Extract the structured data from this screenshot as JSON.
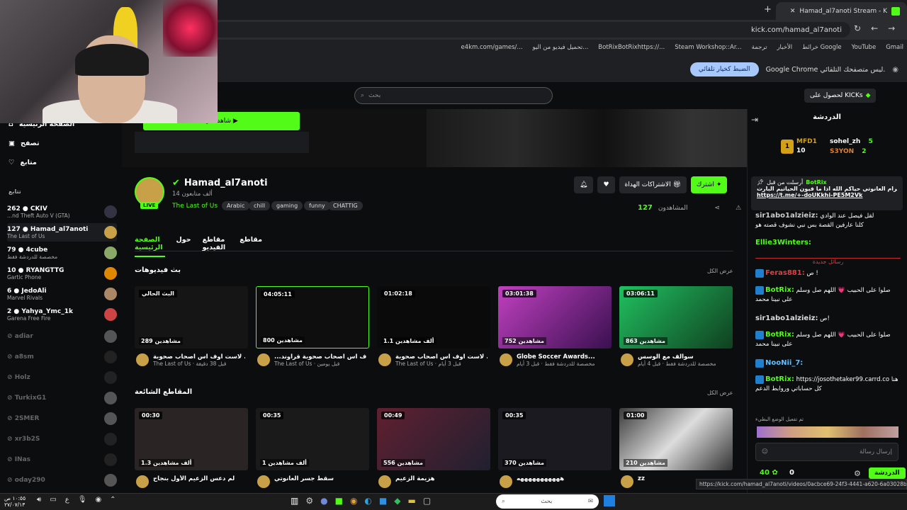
{
  "browser": {
    "tab_title": "Hamad_al7anoti Stream - K",
    "url": "kick.com/hamad_al7anoti",
    "bookmarks": [
      "Gmail",
      "YouTube",
      "خرائط Google",
      "الأخبار",
      "ترجمة",
      "Steam Workshop::Ar...",
      "BotRixBotRixhttps://...",
      "تحميل فيديو من اليو...",
      "e4km.com/games/..."
    ],
    "infobar_msg": "Google Chrome ليس متصفحك التلقائي.",
    "infobar_btn": "الضبط كخيار تلقائي"
  },
  "header": {
    "search_placeholder": "بحث",
    "kicks_label": "لحصول على KICKs"
  },
  "leftnav": {
    "items": [
      "الصفحة الرئيسية",
      "تصفح",
      "متابع"
    ],
    "following_label": "تتابع",
    "channels": [
      {
        "count": "262",
        "name": "CKIV",
        "game": "...nd Theft Auto V (GTA)"
      },
      {
        "count": "127",
        "name": "Hamad_al7anoti",
        "game": "The Last of Us"
      },
      {
        "count": "79",
        "name": "4cube",
        "game": "مخصصة للدردشة فقط"
      },
      {
        "count": "10",
        "name": "RYANGTTG",
        "game": "Gartic Phone"
      },
      {
        "count": "6",
        "name": "JedoAli",
        "game": "Marvel Rivals"
      },
      {
        "count": "2",
        "name": "Yahya_Ymc_1k",
        "game": "Garena Free Fire"
      }
    ],
    "offline": [
      "adiar",
      "a8sm",
      "Holz",
      "TurkixG1",
      "2SMER",
      "xr3b2S",
      "INas",
      "oday290"
    ]
  },
  "banner": {
    "watch_label": "شاهد الآن ▶"
  },
  "profile": {
    "name": "Hamad_al7anoti",
    "followers": "14 ألف متابعون",
    "category": "The Last of Us",
    "tags": [
      "Arabic",
      "chill",
      "gaming",
      "funny",
      "CHATTIG"
    ],
    "live": "LIVE",
    "subscribe": "اشترك",
    "gift": "الاشتراكات الهداة",
    "viewers_label": "المشاهدون",
    "viewers": "127"
  },
  "tabs": [
    "الصفحة الرئيسية",
    "حول",
    "مقاطع الفيديو",
    "مقاطع"
  ],
  "sections": {
    "vods_title": "بث فيديوهات",
    "clips_title": "المقاطع الشائعة",
    "view_all": "عرض الكل"
  },
  "vods": [
    {
      "dur": "البث الحالي",
      "views": "289 مشاهدين",
      "title": "لاست اوف اس اصحاب صحوبة ...",
      "sub": "The Last of Us · قبل 38 دقيقة"
    },
    {
      "dur": "04:05:11",
      "views": "800 مشاهدين",
      "title": "...ف اس اصحاب صحوبة قراوند",
      "sub": "The Last of Us · قبل يومين"
    },
    {
      "dur": "01:02:18",
      "views": "1.1 ألف مشاهدين",
      "title": "لاست اوف اس اصحاب صحوبة ...",
      "sub": "The Last of Us · قبل 3 أيام"
    },
    {
      "dur": "03:01:38",
      "views": "752 مشاهدين",
      "title": "Globe Soccer Awards...",
      "sub": "مخصصة للدردشة فقط · قبل 3 أيام"
    },
    {
      "dur": "03:06:11",
      "views": "863 مشاهدين",
      "title": "سوالف مع الوسس",
      "sub": "مخصصة للدردشة فقط · قبل 4 أيام"
    }
  ],
  "clips": [
    {
      "dur": "00:30",
      "views": "1.3 ألف مشاهدين",
      "title": "لم دعس الزعيم الأول بنجاح"
    },
    {
      "dur": "00:35",
      "views": "1 ألف مشاهدين",
      "title": "سقط جسر العانوتي"
    },
    {
      "dur": "00:49",
      "views": "556 مشاهدين",
      "title": "هزيمة الزعيم"
    },
    {
      "dur": "00:35",
      "views": "370 مشاهدين",
      "title": "هههههههههههه"
    },
    {
      "dur": "01:00",
      "views": "210 مشاهدين",
      "title": "zz"
    }
  ],
  "chat": {
    "title": "الدردشة",
    "leaders": [
      {
        "name": "MFD1",
        "n": "10"
      },
      {
        "name": "sohel_zh",
        "n": "5"
      },
      {
        "name": "S3YON",
        "n": "2"
      }
    ],
    "pinned_user": "BotRix",
    "pinned_by": "أرسلت من قبل",
    "pinned_text": "هذا تلقرام العانوتي حياكم الله اذا ما فيون الحياتيم البارت",
    "pinned_link": "https://t.me/+-doUKkhi-PE5M2Vk",
    "new_msgs": "رسائل جديدة",
    "messages": [
      {
        "user": "sir1abo1alzieiz:",
        "text": "لقل فيصل عند الوادي"
      },
      {
        "user": "",
        "text": "كلنا عارفين القصة بس نبي نشوف قصته هو"
      },
      {
        "user": "Ellie3Winters:",
        "text": ""
      },
      {
        "user": "Feras881:",
        "text": "ص !"
      },
      {
        "user": "BotRix:",
        "text": "صلوا على الحبيب 💗 اللهم صل وسلم على نبينا محمد"
      },
      {
        "user": "sir1abo1alzieiz:",
        "text": "ص!"
      },
      {
        "user": "BotRix:",
        "text": "صلوا على الحبيب 💗 اللهم صل وسلم على نبينا محمد"
      },
      {
        "user": "NooNii_7:",
        "text": ""
      },
      {
        "user": "BotRix:",
        "text": "https://josothetaker99.carrd.co هنا كل حساباتي وروابط الدعم"
      }
    ],
    "input_placeholder": "إرسال رسالة",
    "send": "الدردشة",
    "points": "40",
    "count": "0",
    "slow_mode": "تم تفعيل الوضع البطيء"
  },
  "status_url": "https://kick.com/hamad_al7anoti/videos/0acbce69-24f3-4441-a620-6a03028b8bbb",
  "taskbar": {
    "search": "بحث",
    "time": "١٠:٥٥ ص",
    "date": "٢٧/٠٧/١٣"
  }
}
